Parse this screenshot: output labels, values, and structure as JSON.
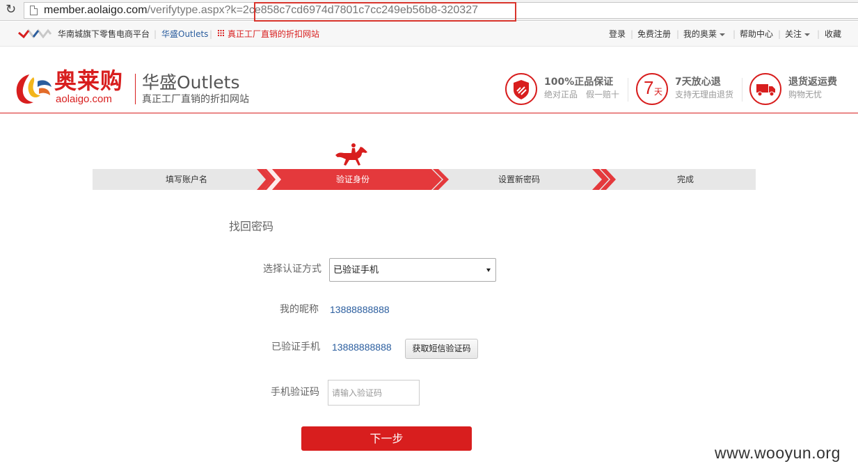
{
  "browser": {
    "url_host": "member.aolaigo.com",
    "url_path": "/verifytype.aspx?k=2ce858c7cd6974d7801c7cc249eb56b8-320327"
  },
  "topnav": {
    "platform_text": "华南城旗下零售电商平台",
    "outlets_link": "华盛Outlets",
    "factory_link": "真正工厂直销的折扣网站",
    "login": "登录",
    "register": "免费注册",
    "my_account": "我的奥莱",
    "help": "帮助中心",
    "follow": "关注",
    "favorite": "收藏",
    "sep": "|"
  },
  "header": {
    "brand": "奥莱购",
    "brand_url": "aolaigo.com",
    "outlets_title": "华盛Outlets",
    "outlets_sub": "真正工厂直销的折扣网站",
    "badges": [
      {
        "icon": "shield-icon",
        "title": "100%正品保证",
        "sub": "绝对正品　假一赔十"
      },
      {
        "icon": "7-day-icon",
        "glyph_num": "7",
        "glyph_text": "天",
        "title": "7天放心退",
        "sub": "支持无理由退货"
      },
      {
        "icon": "truck-icon",
        "title": "退货返运费",
        "sub": "购物无忧"
      }
    ]
  },
  "steps": {
    "items": [
      "填写账户名",
      "验证身份",
      "设置新密码",
      "完成"
    ],
    "active_index": 1,
    "active_color": "#e4393c"
  },
  "form": {
    "title": "找回密码",
    "verify_label": "选择认证方式",
    "verify_value": "已验证手机",
    "nickname_label": "我的昵称",
    "nickname_value": "13888888888",
    "phone_label": "已验证手机",
    "phone_value": "13888888888",
    "sms_button": "获取短信验证码",
    "code_label": "手机验证码",
    "code_placeholder": "请输入验证码",
    "next_button": "下一步"
  },
  "watermark": "www.wooyun.org",
  "colors": {
    "brand_red": "#d81e1e",
    "link_blue": "#2a5d9e"
  }
}
